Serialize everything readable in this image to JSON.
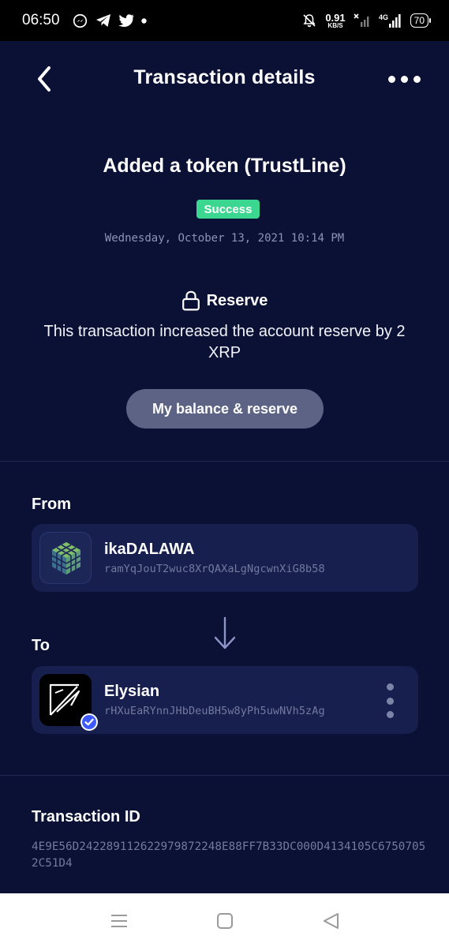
{
  "status_bar": {
    "time": "06:50",
    "speed_value": "0.91",
    "speed_unit": "KB/S",
    "battery": "70",
    "network": "4G"
  },
  "header": {
    "title": "Transaction details",
    "back_icon": "chevron-left-icon",
    "more_icon": "more-horizontal-icon"
  },
  "transaction": {
    "title": "Added a token (TrustLine)",
    "status": "Success",
    "date": "Wednesday, October 13, 2021 10:14 PM"
  },
  "reserve": {
    "label": "Reserve",
    "description": "This transaction increased the account reserve by 2 XRP",
    "button_label": "My balance & reserve"
  },
  "from": {
    "label": "From",
    "name": "ikaDALAWA",
    "address": "ramYqJouT2wuc8XrQAXaLgNgcwnXiG8b58"
  },
  "to": {
    "label": "To",
    "name": "Elysian",
    "address": "rHXuEaRYnnJHbDeuBH5w8yPh5uwNVh5zAg"
  },
  "transaction_id": {
    "label": "Transaction ID",
    "value": "4E9E56D242289112622979872248E88FF7B33DC000D4134105C67507052C51D4"
  },
  "colors": {
    "app_background": "#0a1135",
    "card_background": "#161f4d",
    "success": "#3bd68f",
    "button": "#5c6384",
    "verified": "#3d5afe"
  }
}
